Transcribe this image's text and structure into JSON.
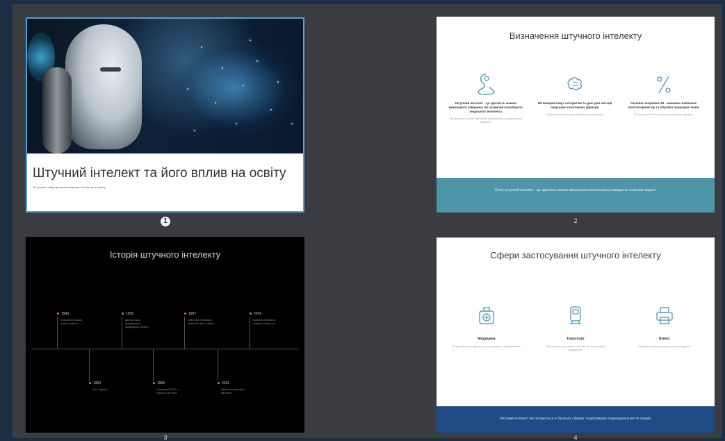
{
  "slides": [
    {
      "number": "1",
      "title": "Штучний інтелект та його вплив на освіту",
      "subtitle": "Вступний слайд про вплив штучного інтелекту на освіту"
    },
    {
      "number": "2",
      "title": "Визначення штучного інтелекту",
      "columns": [
        {
          "icon": "head-silhouette-icon",
          "heading": "Штучний інтелект - це здатність машин виконувати завдання, які зазвичай потребують людського інтелекту.",
          "text": "Це включає в себе навчання, міркування та розв'язання проблем."
        },
        {
          "icon": "brain-icon",
          "heading": "ШІ використовує алгоритми та дані для імітації людських когнітивних функцій.",
          "text": "Це дозволяє машинам навчатися на досвіді."
        },
        {
          "icon": "percent-icon",
          "heading": "Основні напрямки ШІ - машинне навчання, комп'ютерний зір та обробка природної мови.",
          "text": "Ці технології застосовуються в різних сферах."
        }
      ],
      "footer": "Отже, штучний інтелект - це здатність машин виконувати інтелектуальні завдання, властиві людині."
    },
    {
      "number": "3",
      "title": "Історія штучного інтелекту",
      "events": [
        {
          "year": "1943",
          "text": "Створення першої моделі нейрона"
        },
        {
          "year": "1956",
          "text": "Дартмутська конференція, народження терміну"
        },
        {
          "year": "1997",
          "text": "Deep Blue перемагає чемпіона світу з шахів"
        },
        {
          "year": "2016",
          "text": "AlphaGo перемагає чемпіона світу з го"
        },
        {
          "year": "1950",
          "text": "Тест Тюрінга"
        },
        {
          "year": "1966",
          "text": "Створення ELIZA — першого чат-бота"
        },
        {
          "year": "2011",
          "text": "Watson перемагає у вікторині"
        }
      ]
    },
    {
      "number": "4",
      "title": "Сфери застосування штучного інтелекту",
      "columns": [
        {
          "icon": "medical-bag-icon",
          "heading": "Медицина",
          "text": "ШІ допомагає в діагностиці та лікуванні захворювань."
        },
        {
          "icon": "train-icon",
          "heading": "Транспорт",
          "text": "Автономні транспортні засоби та оптимізація маршрутів."
        },
        {
          "icon": "printer-icon",
          "heading": "Бізнес",
          "text": "Автоматизація процесів та аналіз даних."
        }
      ],
      "footer": "Штучний інтелект застосовується в багатьох сферах та допомагає покращувати життя людей."
    }
  ],
  "colors": {
    "background": "#1b2e43",
    "panel": "#3a3c41",
    "selected_border": "#4ea3d8",
    "teal_band": "#4e95aa",
    "navy_band": "#1e4b86",
    "timeline_accent": "#e07b22"
  }
}
